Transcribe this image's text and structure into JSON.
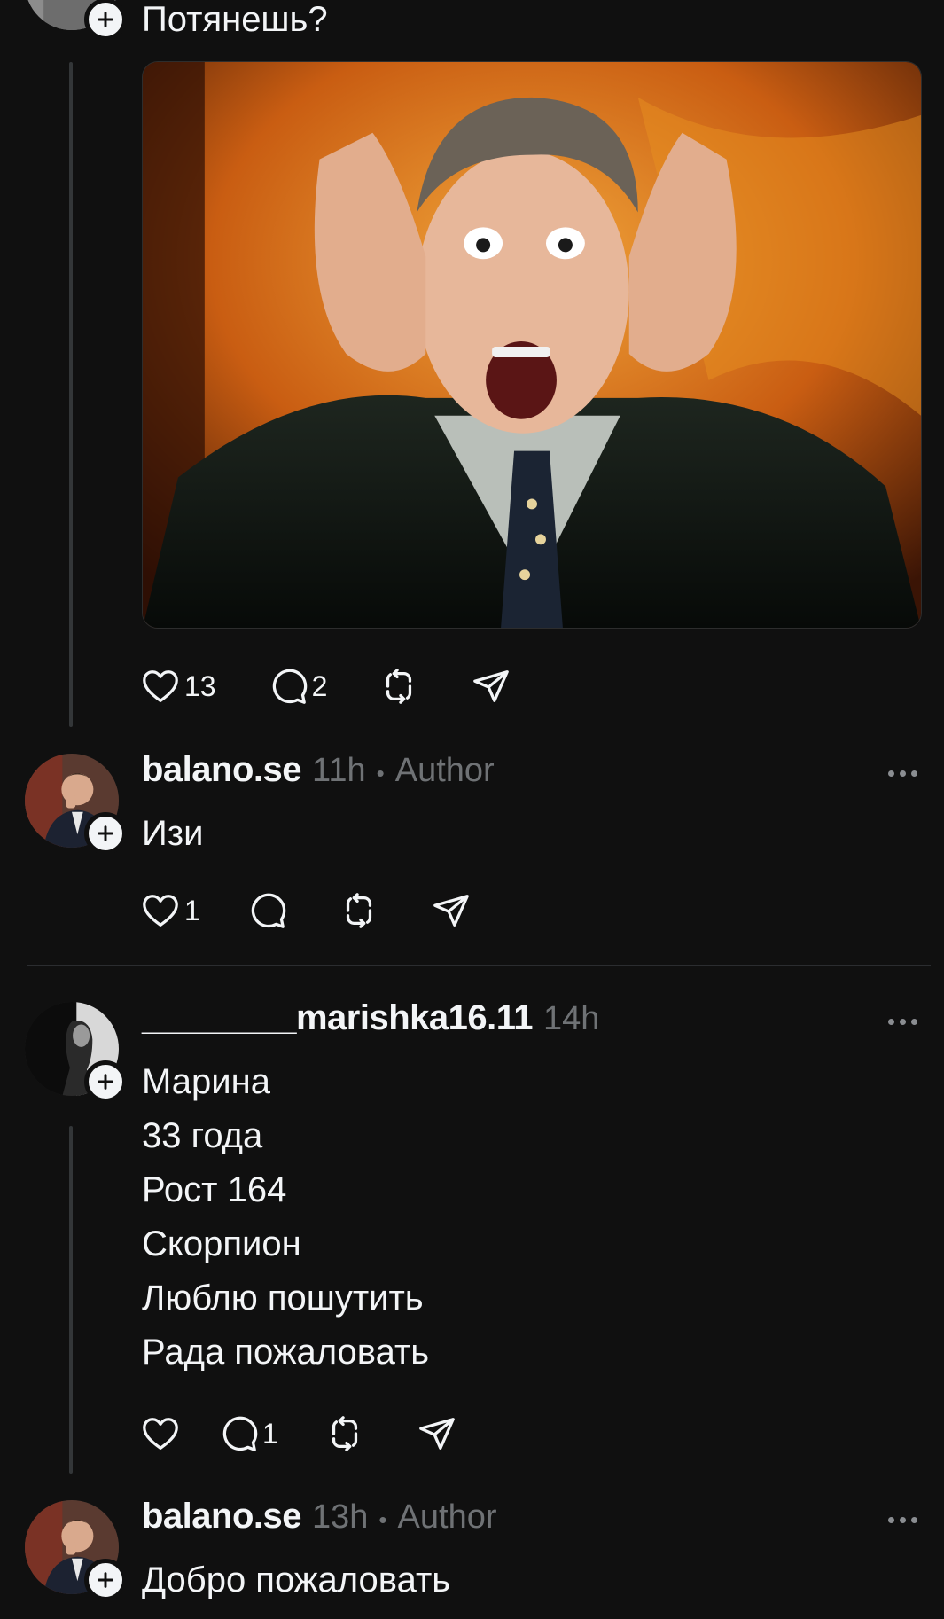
{
  "post0": {
    "text": "Потянешь?",
    "likes": "13",
    "replies": "2"
  },
  "reply1": {
    "username": "balano.se",
    "time": "11h",
    "separator": "•",
    "badge": "Author",
    "text": "Изи",
    "likes": "1"
  },
  "reply2": {
    "username": "________marishka16.11",
    "time": "14h",
    "lines": [
      "Марина",
      "33 года",
      "Рост 164",
      "Скорпион",
      "Люблю пошутить",
      "Рада пожаловать"
    ],
    "replies": "1"
  },
  "reply3": {
    "username": "balano.se",
    "time": "13h",
    "separator": "•",
    "badge": "Author",
    "text": "Добро пожаловать"
  },
  "colors": {
    "background": "#101010",
    "text": "#f3f5f7",
    "secondary": "#6f7275"
  }
}
